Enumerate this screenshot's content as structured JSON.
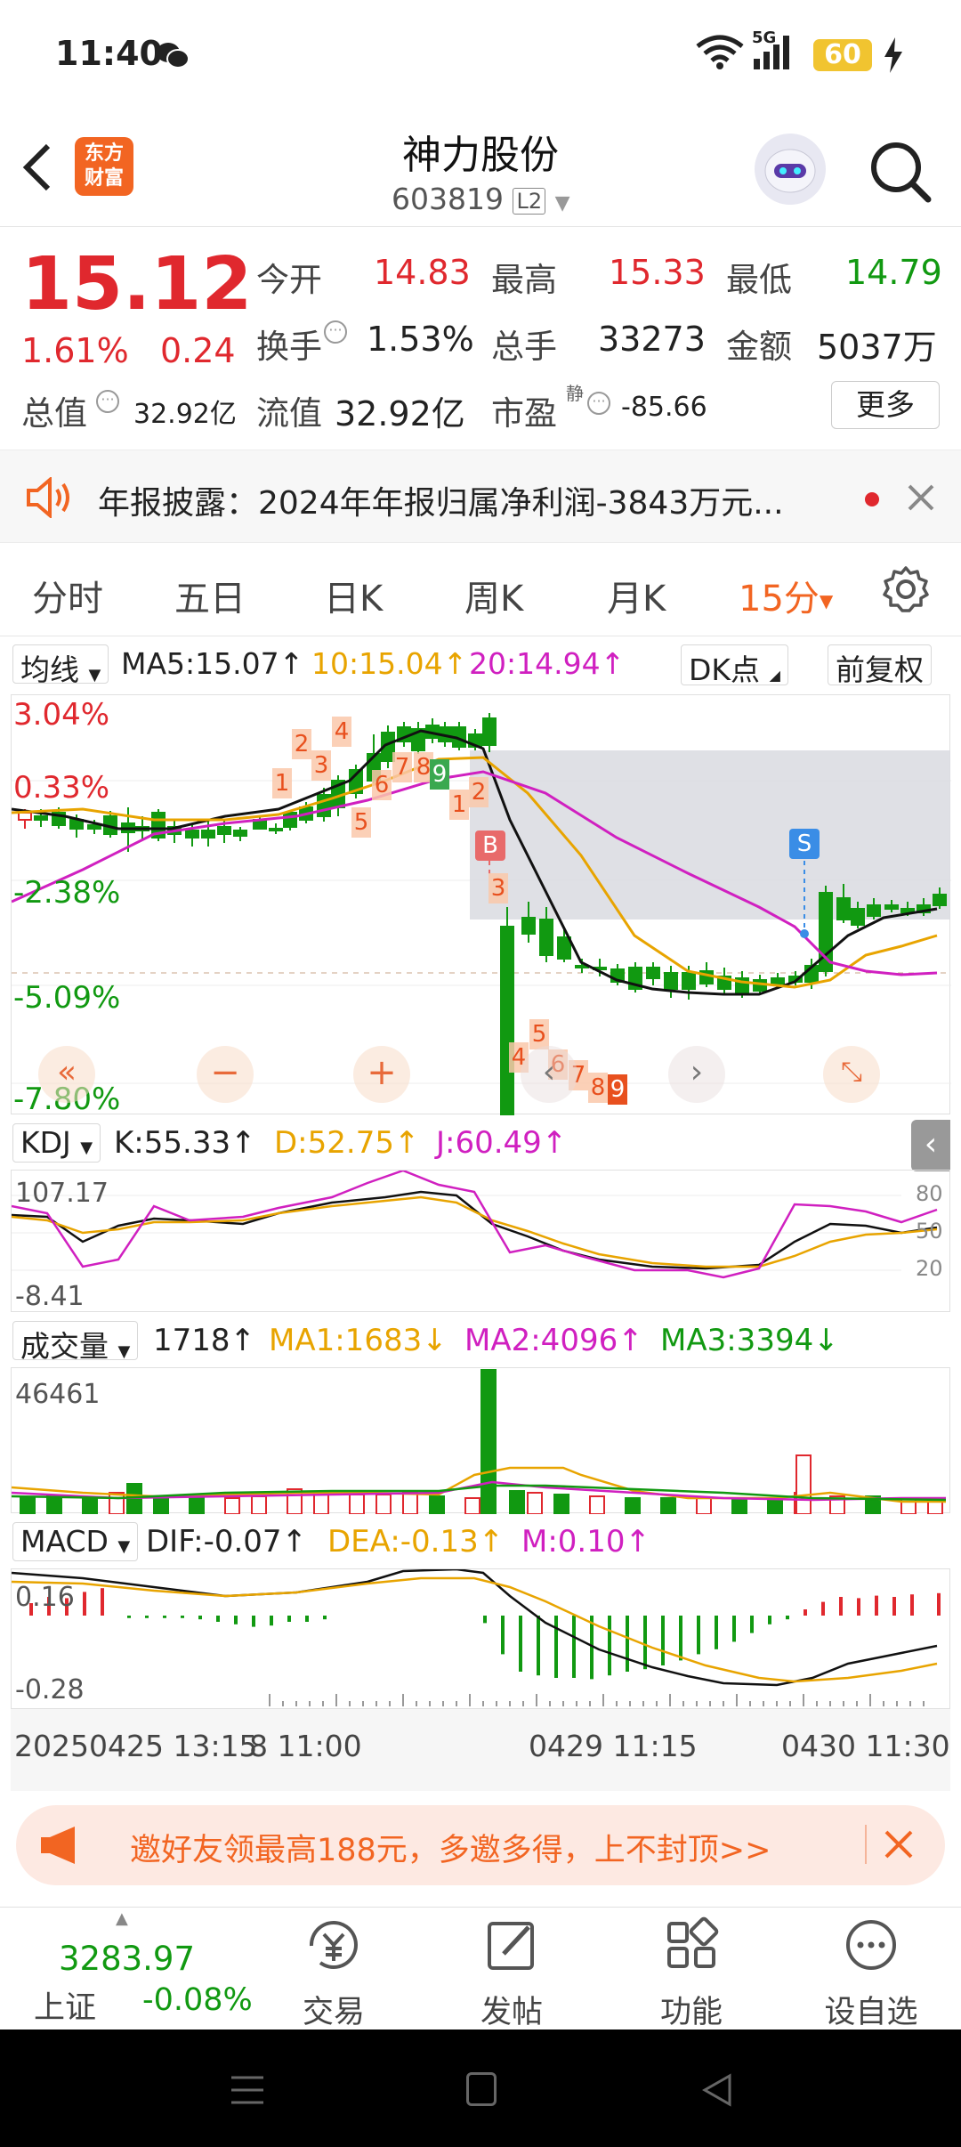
{
  "status_bar": {
    "time": "11:40",
    "network": "5G",
    "battery": "60"
  },
  "header": {
    "logo_text": "东方\n财富",
    "stock_name": "神力股份",
    "stock_code": "603819",
    "level_badge": "L2"
  },
  "quote": {
    "price": "15.12",
    "change_pct": "1.61%",
    "change_amt": "0.24",
    "open_label": "今开",
    "open": "14.83",
    "high_label": "最高",
    "high": "15.33",
    "low_label": "最低",
    "low": "14.79",
    "turnover_label": "换手",
    "turnover": "1.53%",
    "volume_label": "总手",
    "volume": "33273",
    "amount_label": "金额",
    "amount": "5037万",
    "total_cap_label": "总值",
    "total_cap": "32.92亿",
    "float_cap_label": "流值",
    "float_cap": "32.92亿",
    "pe_label": "市盈",
    "pe_sup": "静",
    "pe": "-85.66",
    "more_button": "更多"
  },
  "notice": {
    "text": "年报披露：2024年年报归属净利润-3843万元..."
  },
  "tabs": [
    "分时",
    "五日",
    "日K",
    "周K",
    "月K",
    "15分"
  ],
  "ma_bar": {
    "select": "均线",
    "ma5": "MA5:15.07",
    "ma10": "10:15.04",
    "ma20": "20:14.94",
    "dk_button": "DK点",
    "adjust_button": "前复权"
  },
  "main_chart": {
    "y_labels": [
      "3.04%",
      "0.33%",
      "-2.38%",
      "-5.09%",
      "-7.80%"
    ],
    "buy_marker": "B",
    "sell_marker": "S",
    "count_labels": [
      "1",
      "2",
      "3",
      "4",
      "5",
      "6",
      "7",
      "8",
      "9",
      "1",
      "2",
      "3",
      "4",
      "5",
      "6",
      "7",
      "8",
      "9"
    ]
  },
  "kdj": {
    "select": "KDJ",
    "k": "K:55.33",
    "d": "D:52.75",
    "j": "J:60.49",
    "y_top": "107.17",
    "y_bottom": "-8.41",
    "right_ticks": [
      "80",
      "50",
      "20"
    ]
  },
  "volume": {
    "select": "成交量",
    "value": "1718",
    "ma1": "MA1:1683",
    "ma2": "MA2:4096",
    "ma3": "MA3:3394",
    "y_top": "46461"
  },
  "macd": {
    "select": "MACD",
    "dif": "DIF:-0.07",
    "dea": "DEA:-0.13",
    "m": "M:0.10",
    "y_top": "0.16",
    "y_bottom": "-0.28"
  },
  "time_axis": {
    "start": "20250425 13:15",
    "first_tick": "8 11:00",
    "mid": "0429 11:15",
    "end": "0430 11:30"
  },
  "banner": {
    "text": "邀好友领最高188元，多邀多得，上不封顶>>"
  },
  "bottom_nav": {
    "index_value": "3283.97",
    "index_name": "上证",
    "index_change": "-0.08%",
    "items": [
      "交易",
      "发帖",
      "功能",
      "设自选"
    ]
  },
  "colors": {
    "up": "#e0282e",
    "down": "#119911",
    "ma10": "#e8a400",
    "ma20": "#d020c0",
    "accent": "#f26522"
  }
}
